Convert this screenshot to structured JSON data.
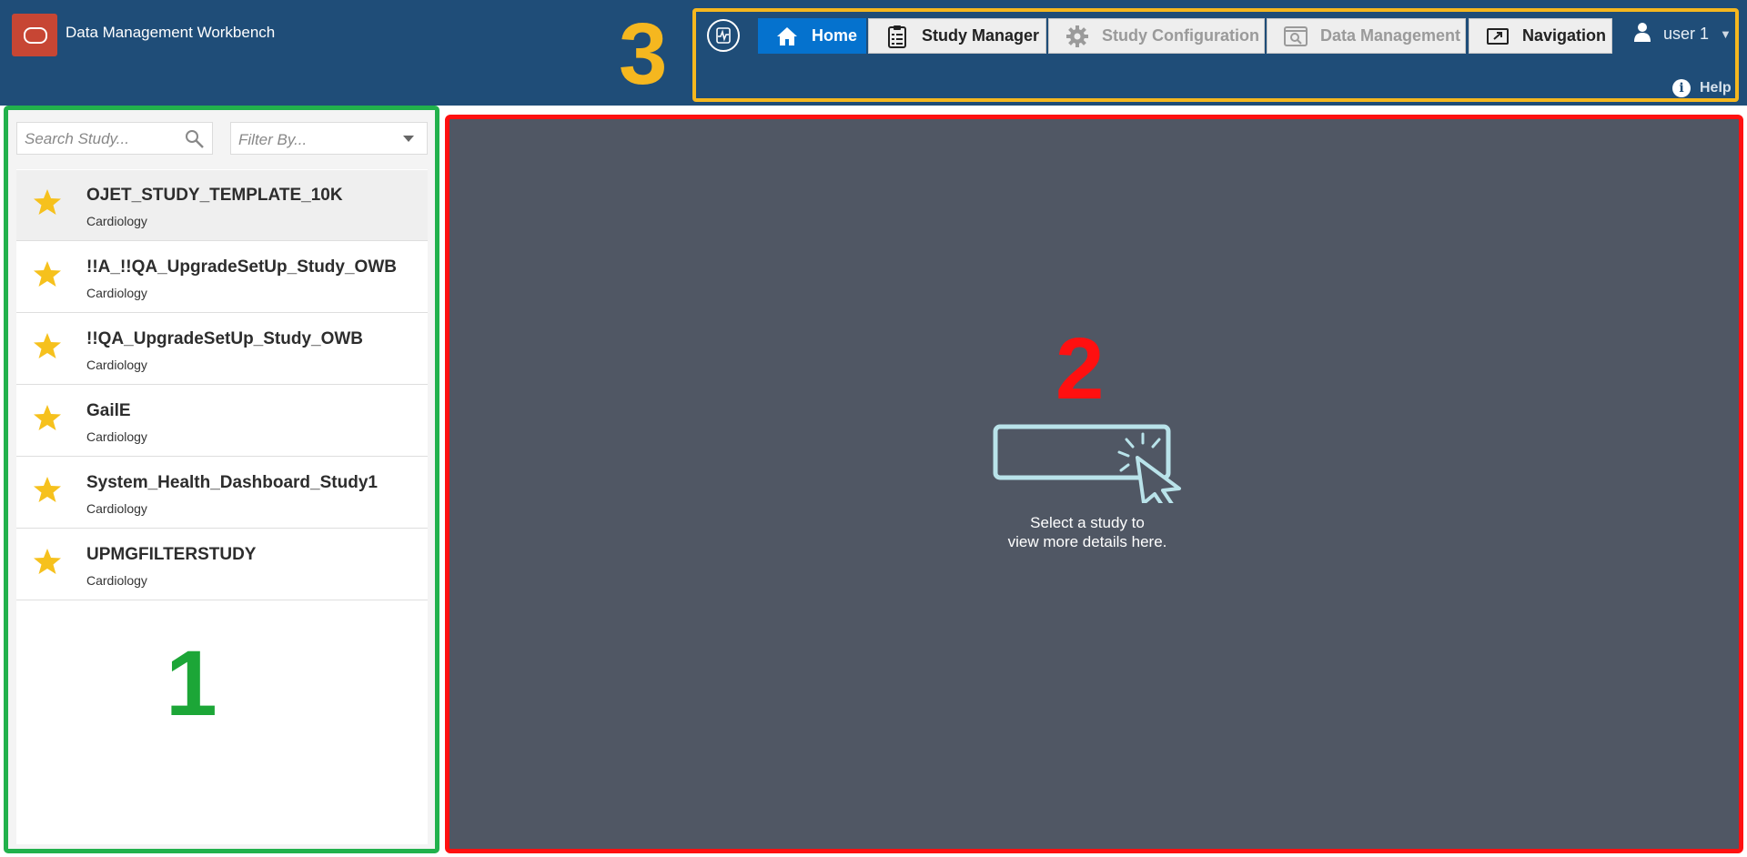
{
  "header": {
    "app_title": "Data Management Workbench",
    "nav": [
      {
        "label": "Home",
        "icon": "home-icon",
        "state": "active"
      },
      {
        "label": "Study Manager",
        "icon": "clipboard-icon",
        "state": "enabled"
      },
      {
        "label": "Study Configuration",
        "icon": "gear-icon",
        "state": "disabled"
      },
      {
        "label": "Data Management",
        "icon": "data-view-icon",
        "state": "disabled"
      },
      {
        "label": "Navigation",
        "icon": "navigation-icon",
        "state": "enabled"
      }
    ],
    "user": "user 1",
    "help": "Help",
    "brand_color": "#1f4d78",
    "active_color": "#0572ce"
  },
  "sidebar": {
    "search_placeholder": "Search Study...",
    "filter_placeholder": "Filter By...",
    "studies": [
      {
        "name": "OJET_STUDY_TEMPLATE_10K",
        "category": "Cardiology",
        "favorite": true,
        "selected": true
      },
      {
        "name": "!!A_!!QA_UpgradeSetUp_Study_OWB",
        "category": "Cardiology",
        "favorite": true
      },
      {
        "name": "!!QA_UpgradeSetUp_Study_OWB",
        "category": "Cardiology",
        "favorite": true
      },
      {
        "name": "GailE",
        "category": "Cardiology",
        "favorite": true
      },
      {
        "name": "System_Health_Dashboard_Study1",
        "category": "Cardiology",
        "favorite": true
      },
      {
        "name": "UPMGFILTERSTUDY",
        "category": "Cardiology",
        "favorite": true
      }
    ]
  },
  "main": {
    "empty_line1": "Select a study to",
    "empty_line2": "view more details here."
  },
  "annotations": {
    "marker1": "1",
    "marker2": "2",
    "marker3": "3",
    "colors": {
      "marker1": "#1ca637",
      "marker2": "#ff1010",
      "marker3": "#f5b71f"
    }
  }
}
